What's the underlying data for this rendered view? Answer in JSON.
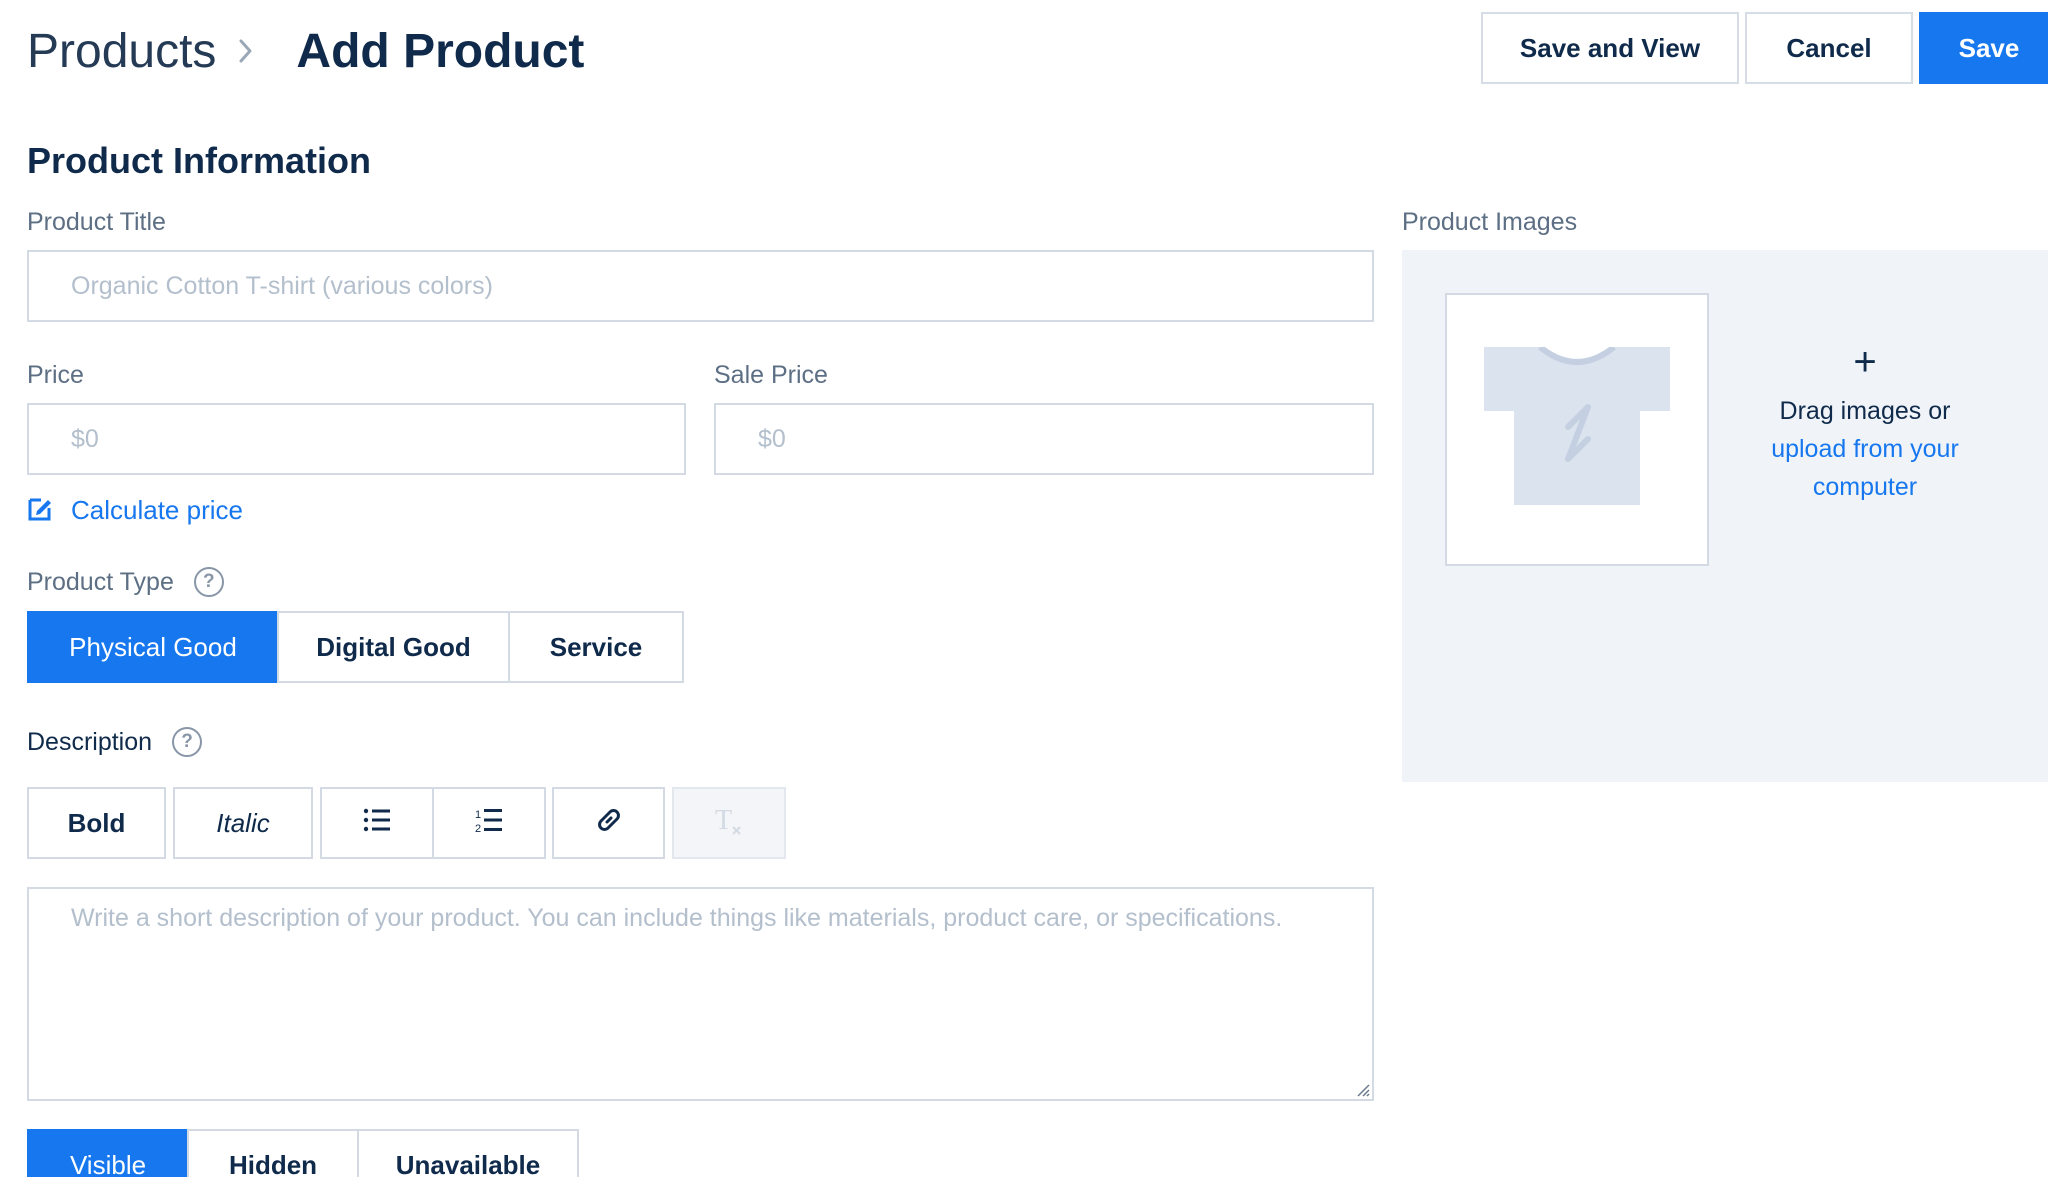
{
  "header": {
    "breadcrumb_root": "Products",
    "breadcrumb_current": "Add Product",
    "save_and_view_label": "Save and View",
    "cancel_label": "Cancel",
    "save_label": "Save"
  },
  "product_info": {
    "section_title": "Product Information",
    "title_label": "Product Title",
    "title_placeholder": "Organic Cotton T-shirt (various colors)",
    "price_label": "Price",
    "price_placeholder": "$0",
    "sale_price_label": "Sale Price",
    "sale_price_placeholder": "$0",
    "calculate_price_label": "Calculate price",
    "product_type_label": "Product Type",
    "product_types": [
      {
        "label": "Physical Good",
        "selected": true
      },
      {
        "label": "Digital Good",
        "selected": false
      },
      {
        "label": "Service",
        "selected": false
      }
    ],
    "description_label": "Description",
    "toolbar": {
      "bold_label": "Bold",
      "italic_label": "Italic",
      "icons": [
        "bulleted-list-icon",
        "numbered-list-icon",
        "link-icon",
        "clear-format-icon"
      ]
    },
    "description_placeholder": "Write a short description of your product. You can include things like materials, product care, or specifications.",
    "visibility_options": [
      {
        "label": "Visible",
        "selected": true
      },
      {
        "label": "Hidden",
        "selected": false
      },
      {
        "label": "Unavailable",
        "selected": false
      }
    ]
  },
  "images": {
    "label": "Product Images",
    "plus": "+",
    "drag_text": "Drag images or",
    "upload_link": "upload from your computer"
  },
  "colors": {
    "accent": "#1677ef",
    "text_dark": "#0f2a4a",
    "text_muted": "#5d6f84",
    "border": "#d3dae3",
    "panel_bg": "#f0f4f8",
    "placeholder": "#b3bfcc"
  }
}
